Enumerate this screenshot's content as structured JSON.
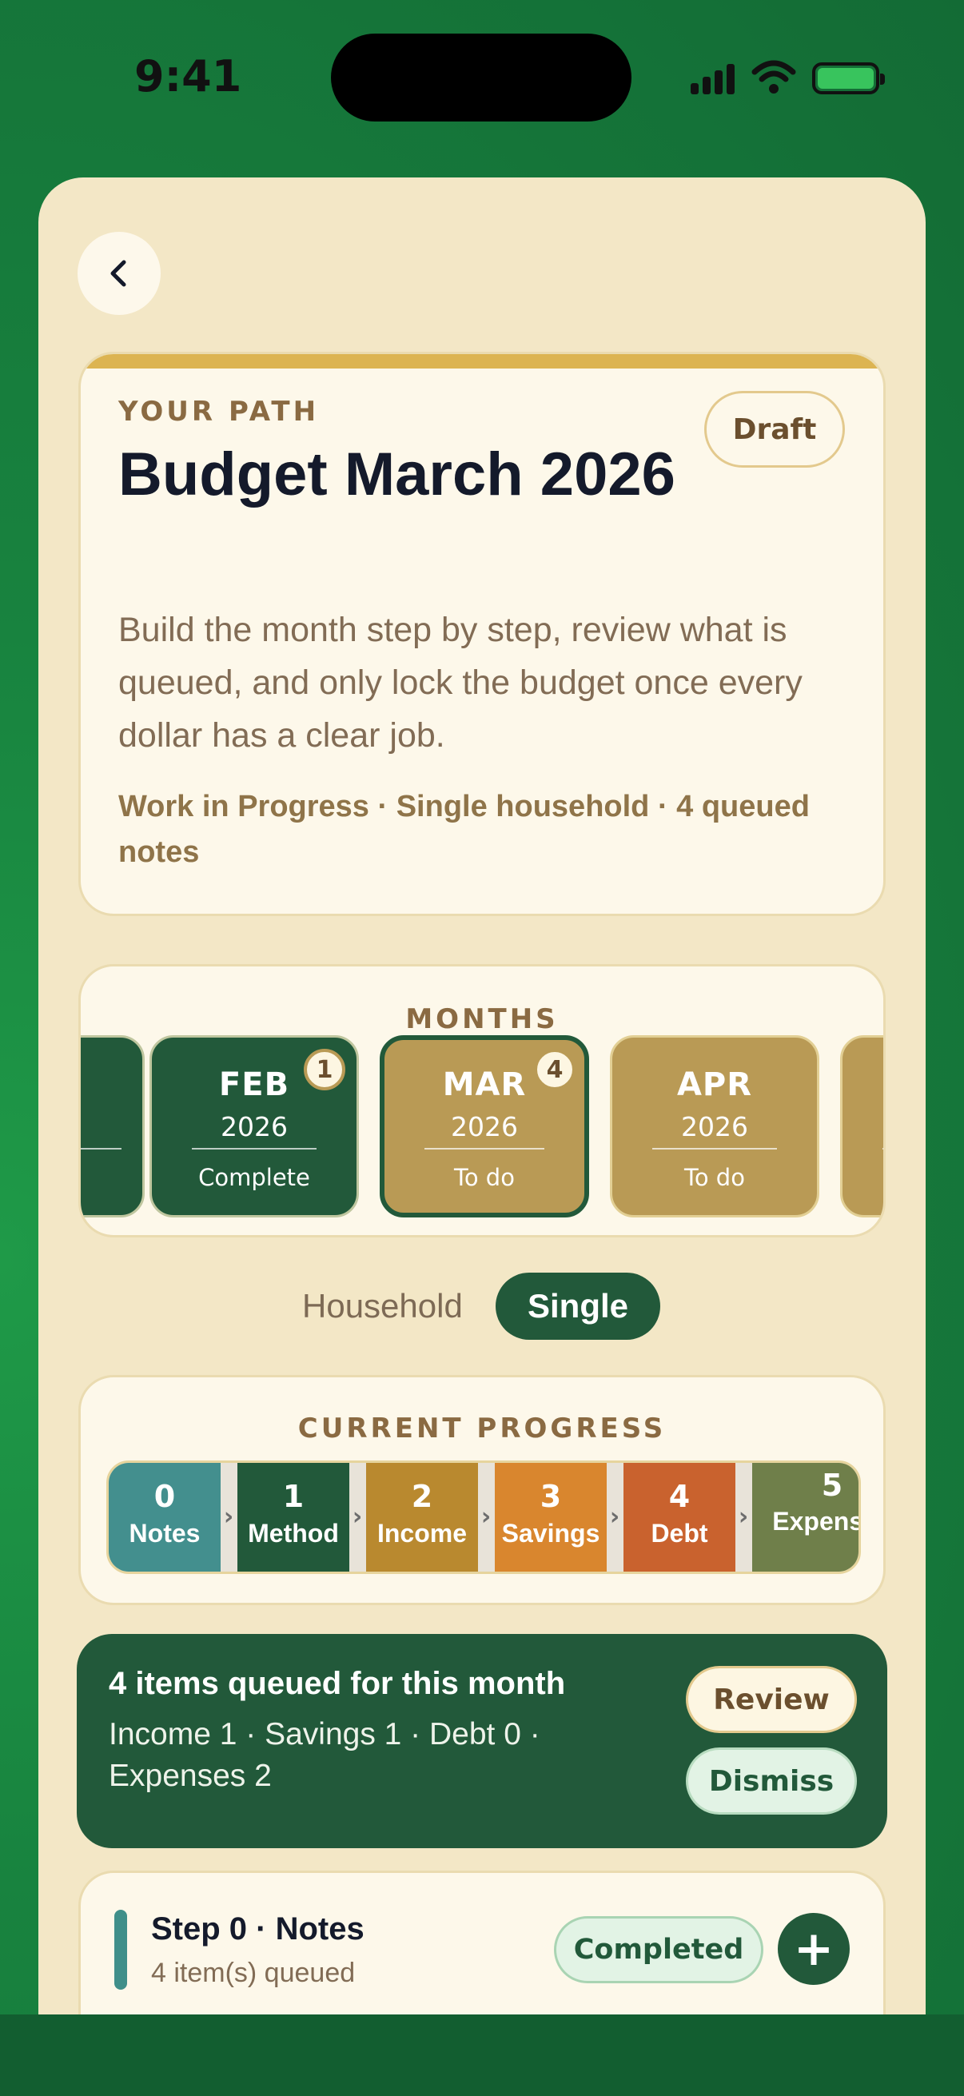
{
  "status_bar": {
    "time": "9:41"
  },
  "path": {
    "eyebrow": "YOUR PATH",
    "title": "Budget March 2026",
    "status_pill": "Draft",
    "description": "Build the month step by step, review what is queued, and only lock the budget once every dollar has a clear job.",
    "meta": "Work in Progress · Single household · 4 queued notes"
  },
  "months": {
    "label": "MONTHS",
    "items": [
      {
        "name": "FEB",
        "year": "2026",
        "status": "Complete",
        "badge": "1"
      },
      {
        "name": "MAR",
        "year": "2026",
        "status": "To do",
        "badge": "4"
      },
      {
        "name": "APR",
        "year": "2026",
        "status": "To do"
      }
    ]
  },
  "household": {
    "label": "Household",
    "value": "Single"
  },
  "progress": {
    "label": "CURRENT PROGRESS",
    "steps": [
      {
        "num": "0",
        "name": "Notes",
        "color": "#438f8e"
      },
      {
        "num": "1",
        "name": "Method",
        "color": "#22593a"
      },
      {
        "num": "2",
        "name": "Income",
        "color": "#b9892f"
      },
      {
        "num": "3",
        "name": "Savings",
        "color": "#d9862e"
      },
      {
        "num": "4",
        "name": "Debt",
        "color": "#c9622e"
      },
      {
        "num": "5",
        "name": "Expenses",
        "color": "#6f7f4a"
      }
    ]
  },
  "queue": {
    "title": "4 items queued for this month",
    "detail": "Income 1 · Savings 1 · Debt 0 · Expenses 2",
    "review_label": "Review",
    "dismiss_label": "Dismiss"
  },
  "step_card": {
    "title": "Step 0 · Notes",
    "subtitle": "4 item(s) queued",
    "status_pill": "Completed",
    "add_label": "+"
  }
}
